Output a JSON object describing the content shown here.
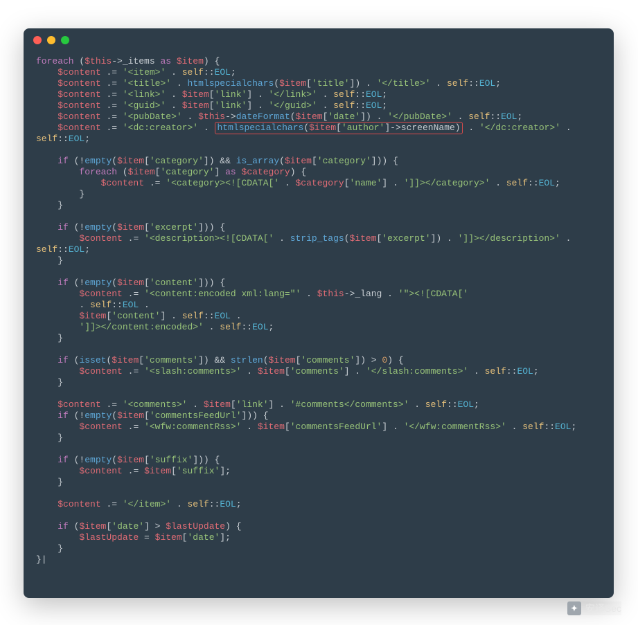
{
  "watermark": {
    "label": "安译Sec"
  },
  "code": {
    "tokens": [
      [
        [
          "kw",
          "foreach"
        ],
        [
          "op",
          " ("
        ],
        [
          "var",
          "$this"
        ],
        [
          "op",
          "->"
        ],
        [
          "plain",
          "_items "
        ],
        [
          "kw",
          "as"
        ],
        [
          "plain",
          " "
        ],
        [
          "var",
          "$item"
        ],
        [
          "op",
          ") {"
        ]
      ],
      [
        [
          "plain",
          "    "
        ],
        [
          "var",
          "$content"
        ],
        [
          "op",
          " .= "
        ],
        [
          "str",
          "'<item>'"
        ],
        [
          "op",
          " . "
        ],
        [
          "cls",
          "self"
        ],
        [
          "op",
          "::"
        ],
        [
          "cnst",
          "EOL"
        ],
        [
          "op",
          ";"
        ]
      ],
      [
        [
          "plain",
          "    "
        ],
        [
          "var",
          "$content"
        ],
        [
          "op",
          " .= "
        ],
        [
          "str",
          "'<title>'"
        ],
        [
          "op",
          " . "
        ],
        [
          "fn",
          "htmlspecialchars"
        ],
        [
          "op",
          "("
        ],
        [
          "var",
          "$item"
        ],
        [
          "op",
          "["
        ],
        [
          "str",
          "'title'"
        ],
        [
          "op",
          "]) . "
        ],
        [
          "str",
          "'</title>'"
        ],
        [
          "op",
          " . "
        ],
        [
          "cls",
          "self"
        ],
        [
          "op",
          "::"
        ],
        [
          "cnst",
          "EOL"
        ],
        [
          "op",
          ";"
        ]
      ],
      [
        [
          "plain",
          "    "
        ],
        [
          "var",
          "$content"
        ],
        [
          "op",
          " .= "
        ],
        [
          "str",
          "'<link>'"
        ],
        [
          "op",
          " . "
        ],
        [
          "var",
          "$item"
        ],
        [
          "op",
          "["
        ],
        [
          "str",
          "'link'"
        ],
        [
          "op",
          "] . "
        ],
        [
          "str",
          "'</link>'"
        ],
        [
          "op",
          " . "
        ],
        [
          "cls",
          "self"
        ],
        [
          "op",
          "::"
        ],
        [
          "cnst",
          "EOL"
        ],
        [
          "op",
          ";"
        ]
      ],
      [
        [
          "plain",
          "    "
        ],
        [
          "var",
          "$content"
        ],
        [
          "op",
          " .= "
        ],
        [
          "str",
          "'<guid>'"
        ],
        [
          "op",
          " . "
        ],
        [
          "var",
          "$item"
        ],
        [
          "op",
          "["
        ],
        [
          "str",
          "'link'"
        ],
        [
          "op",
          "] . "
        ],
        [
          "str",
          "'</guid>'"
        ],
        [
          "op",
          " . "
        ],
        [
          "cls",
          "self"
        ],
        [
          "op",
          "::"
        ],
        [
          "cnst",
          "EOL"
        ],
        [
          "op",
          ";"
        ]
      ],
      [
        [
          "plain",
          "    "
        ],
        [
          "var",
          "$content"
        ],
        [
          "op",
          " .= "
        ],
        [
          "str",
          "'<pubDate>'"
        ],
        [
          "op",
          " . "
        ],
        [
          "var",
          "$this"
        ],
        [
          "op",
          "->"
        ],
        [
          "fn",
          "dateFormat"
        ],
        [
          "op",
          "("
        ],
        [
          "var",
          "$item"
        ],
        [
          "op",
          "["
        ],
        [
          "str",
          "'date'"
        ],
        [
          "op",
          "]) . "
        ],
        [
          "str",
          "'</pubDate>'"
        ],
        [
          "op",
          " . "
        ],
        [
          "cls",
          "self"
        ],
        [
          "op",
          "::"
        ],
        [
          "cnst",
          "EOL"
        ],
        [
          "op",
          ";"
        ]
      ],
      "HILITE_LINE",
      [
        [
          "cls",
          "self"
        ],
        [
          "op",
          "::"
        ],
        [
          "cnst",
          "EOL"
        ],
        [
          "op",
          ";"
        ]
      ],
      [],
      [
        [
          "plain",
          "    "
        ],
        [
          "kw",
          "if"
        ],
        [
          "op",
          " (!"
        ],
        [
          "fn",
          "empty"
        ],
        [
          "op",
          "("
        ],
        [
          "var",
          "$item"
        ],
        [
          "op",
          "["
        ],
        [
          "str",
          "'category'"
        ],
        [
          "op",
          "]) && "
        ],
        [
          "fn",
          "is_array"
        ],
        [
          "op",
          "("
        ],
        [
          "var",
          "$item"
        ],
        [
          "op",
          "["
        ],
        [
          "str",
          "'category'"
        ],
        [
          "op",
          "])) {"
        ]
      ],
      [
        [
          "plain",
          "        "
        ],
        [
          "kw",
          "foreach"
        ],
        [
          "op",
          " ("
        ],
        [
          "var",
          "$item"
        ],
        [
          "op",
          "["
        ],
        [
          "str",
          "'category'"
        ],
        [
          "op",
          "] "
        ],
        [
          "kw",
          "as"
        ],
        [
          "plain",
          " "
        ],
        [
          "var",
          "$category"
        ],
        [
          "op",
          ") {"
        ]
      ],
      [
        [
          "plain",
          "            "
        ],
        [
          "var",
          "$content"
        ],
        [
          "op",
          " .= "
        ],
        [
          "str",
          "'<category><![CDATA['"
        ],
        [
          "op",
          " . "
        ],
        [
          "var",
          "$category"
        ],
        [
          "op",
          "["
        ],
        [
          "str",
          "'name'"
        ],
        [
          "op",
          "] . "
        ],
        [
          "str",
          "']]></category>'"
        ],
        [
          "op",
          " . "
        ],
        [
          "cls",
          "self"
        ],
        [
          "op",
          "::"
        ],
        [
          "cnst",
          "EOL"
        ],
        [
          "op",
          ";"
        ]
      ],
      [
        [
          "plain",
          "        "
        ],
        [
          "op",
          "}"
        ]
      ],
      [
        [
          "plain",
          "    "
        ],
        [
          "op",
          "}"
        ]
      ],
      [],
      [
        [
          "plain",
          "    "
        ],
        [
          "kw",
          "if"
        ],
        [
          "op",
          " (!"
        ],
        [
          "fn",
          "empty"
        ],
        [
          "op",
          "("
        ],
        [
          "var",
          "$item"
        ],
        [
          "op",
          "["
        ],
        [
          "str",
          "'excerpt'"
        ],
        [
          "op",
          "])) {"
        ]
      ],
      [
        [
          "plain",
          "        "
        ],
        [
          "var",
          "$content"
        ],
        [
          "op",
          " .= "
        ],
        [
          "str",
          "'<description><![CDATA['"
        ],
        [
          "op",
          " . "
        ],
        [
          "fn",
          "strip_tags"
        ],
        [
          "op",
          "("
        ],
        [
          "var",
          "$item"
        ],
        [
          "op",
          "["
        ],
        [
          "str",
          "'excerpt'"
        ],
        [
          "op",
          "]) . "
        ],
        [
          "str",
          "']]></description>'"
        ],
        [
          "op",
          " . "
        ]
      ],
      [
        [
          "cls",
          "self"
        ],
        [
          "op",
          "::"
        ],
        [
          "cnst",
          "EOL"
        ],
        [
          "op",
          ";"
        ]
      ],
      [
        [
          "plain",
          "    "
        ],
        [
          "op",
          "}"
        ]
      ],
      [],
      [
        [
          "plain",
          "    "
        ],
        [
          "kw",
          "if"
        ],
        [
          "op",
          " (!"
        ],
        [
          "fn",
          "empty"
        ],
        [
          "op",
          "("
        ],
        [
          "var",
          "$item"
        ],
        [
          "op",
          "["
        ],
        [
          "str",
          "'content'"
        ],
        [
          "op",
          "])) {"
        ]
      ],
      [
        [
          "plain",
          "        "
        ],
        [
          "var",
          "$content"
        ],
        [
          "op",
          " .= "
        ],
        [
          "str",
          "'<content:encoded xml:lang=\"'"
        ],
        [
          "op",
          " . "
        ],
        [
          "var",
          "$this"
        ],
        [
          "op",
          "->"
        ],
        [
          "plain",
          "_lang . "
        ],
        [
          "str",
          "'\"><![CDATA['"
        ]
      ],
      [
        [
          "plain",
          "        . "
        ],
        [
          "cls",
          "self"
        ],
        [
          "op",
          "::"
        ],
        [
          "cnst",
          "EOL"
        ],
        [
          "op",
          " ."
        ]
      ],
      [
        [
          "plain",
          "        "
        ],
        [
          "var",
          "$item"
        ],
        [
          "op",
          "["
        ],
        [
          "str",
          "'content'"
        ],
        [
          "op",
          "] . "
        ],
        [
          "cls",
          "self"
        ],
        [
          "op",
          "::"
        ],
        [
          "cnst",
          "EOL"
        ],
        [
          "op",
          " ."
        ]
      ],
      [
        [
          "plain",
          "        "
        ],
        [
          "str",
          "']]></content:encoded>'"
        ],
        [
          "op",
          " . "
        ],
        [
          "cls",
          "self"
        ],
        [
          "op",
          "::"
        ],
        [
          "cnst",
          "EOL"
        ],
        [
          "op",
          ";"
        ]
      ],
      [
        [
          "plain",
          "    "
        ],
        [
          "op",
          "}"
        ]
      ],
      [],
      [
        [
          "plain",
          "    "
        ],
        [
          "kw",
          "if"
        ],
        [
          "op",
          " ("
        ],
        [
          "fn",
          "isset"
        ],
        [
          "op",
          "("
        ],
        [
          "var",
          "$item"
        ],
        [
          "op",
          "["
        ],
        [
          "str",
          "'comments'"
        ],
        [
          "op",
          "]) && "
        ],
        [
          "fn",
          "strlen"
        ],
        [
          "op",
          "("
        ],
        [
          "var",
          "$item"
        ],
        [
          "op",
          "["
        ],
        [
          "str",
          "'comments'"
        ],
        [
          "op",
          "]) > "
        ],
        [
          "num",
          "0"
        ],
        [
          "op",
          ") {"
        ]
      ],
      [
        [
          "plain",
          "        "
        ],
        [
          "var",
          "$content"
        ],
        [
          "op",
          " .= "
        ],
        [
          "str",
          "'<slash:comments>'"
        ],
        [
          "op",
          " . "
        ],
        [
          "var",
          "$item"
        ],
        [
          "op",
          "["
        ],
        [
          "str",
          "'comments'"
        ],
        [
          "op",
          "] . "
        ],
        [
          "str",
          "'</slash:comments>'"
        ],
        [
          "op",
          " . "
        ],
        [
          "cls",
          "self"
        ],
        [
          "op",
          "::"
        ],
        [
          "cnst",
          "EOL"
        ],
        [
          "op",
          ";"
        ]
      ],
      [
        [
          "plain",
          "    "
        ],
        [
          "op",
          "}"
        ]
      ],
      [],
      [
        [
          "plain",
          "    "
        ],
        [
          "var",
          "$content"
        ],
        [
          "op",
          " .= "
        ],
        [
          "str",
          "'<comments>'"
        ],
        [
          "op",
          " . "
        ],
        [
          "var",
          "$item"
        ],
        [
          "op",
          "["
        ],
        [
          "str",
          "'link'"
        ],
        [
          "op",
          "] . "
        ],
        [
          "str",
          "'#comments</comments>'"
        ],
        [
          "op",
          " . "
        ],
        [
          "cls",
          "self"
        ],
        [
          "op",
          "::"
        ],
        [
          "cnst",
          "EOL"
        ],
        [
          "op",
          ";"
        ]
      ],
      [
        [
          "plain",
          "    "
        ],
        [
          "kw",
          "if"
        ],
        [
          "op",
          " (!"
        ],
        [
          "fn",
          "empty"
        ],
        [
          "op",
          "("
        ],
        [
          "var",
          "$item"
        ],
        [
          "op",
          "["
        ],
        [
          "str",
          "'commentsFeedUrl'"
        ],
        [
          "op",
          "])) {"
        ]
      ],
      [
        [
          "plain",
          "        "
        ],
        [
          "var",
          "$content"
        ],
        [
          "op",
          " .= "
        ],
        [
          "str",
          "'<wfw:commentRss>'"
        ],
        [
          "op",
          " . "
        ],
        [
          "var",
          "$item"
        ],
        [
          "op",
          "["
        ],
        [
          "str",
          "'commentsFeedUrl'"
        ],
        [
          "op",
          "] . "
        ],
        [
          "str",
          "'</wfw:commentRss>'"
        ],
        [
          "op",
          " . "
        ],
        [
          "cls",
          "self"
        ],
        [
          "op",
          "::"
        ],
        [
          "cnst",
          "EOL"
        ],
        [
          "op",
          ";"
        ]
      ],
      [
        [
          "plain",
          "    "
        ],
        [
          "op",
          "}"
        ]
      ],
      [],
      [
        [
          "plain",
          "    "
        ],
        [
          "kw",
          "if"
        ],
        [
          "op",
          " (!"
        ],
        [
          "fn",
          "empty"
        ],
        [
          "op",
          "("
        ],
        [
          "var",
          "$item"
        ],
        [
          "op",
          "["
        ],
        [
          "str",
          "'suffix'"
        ],
        [
          "op",
          "])) {"
        ]
      ],
      [
        [
          "plain",
          "        "
        ],
        [
          "var",
          "$content"
        ],
        [
          "op",
          " .= "
        ],
        [
          "var",
          "$item"
        ],
        [
          "op",
          "["
        ],
        [
          "str",
          "'suffix'"
        ],
        [
          "op",
          "];"
        ]
      ],
      [
        [
          "plain",
          "    "
        ],
        [
          "op",
          "}"
        ]
      ],
      [],
      [
        [
          "plain",
          "    "
        ],
        [
          "var",
          "$content"
        ],
        [
          "op",
          " .= "
        ],
        [
          "str",
          "'</item>'"
        ],
        [
          "op",
          " . "
        ],
        [
          "cls",
          "self"
        ],
        [
          "op",
          "::"
        ],
        [
          "cnst",
          "EOL"
        ],
        [
          "op",
          ";"
        ]
      ],
      [],
      [
        [
          "plain",
          "    "
        ],
        [
          "kw",
          "if"
        ],
        [
          "op",
          " ("
        ],
        [
          "var",
          "$item"
        ],
        [
          "op",
          "["
        ],
        [
          "str",
          "'date'"
        ],
        [
          "op",
          "] > "
        ],
        [
          "var",
          "$lastUpdate"
        ],
        [
          "op",
          ") {"
        ]
      ],
      [
        [
          "plain",
          "        "
        ],
        [
          "var",
          "$lastUpdate"
        ],
        [
          "op",
          " = "
        ],
        [
          "var",
          "$item"
        ],
        [
          "op",
          "["
        ],
        [
          "str",
          "'date'"
        ],
        [
          "op",
          "];"
        ]
      ],
      [
        [
          "plain",
          "    "
        ],
        [
          "op",
          "}"
        ]
      ],
      [
        [
          "op",
          "}|"
        ]
      ]
    ],
    "hilite_line": {
      "prefix": [
        [
          "plain",
          "    "
        ],
        [
          "var",
          "$content"
        ],
        [
          "op",
          " .= "
        ],
        [
          "str",
          "'<dc:creator>'"
        ],
        [
          "op",
          " . "
        ]
      ],
      "box": [
        [
          "fn",
          "htmlspecialchars"
        ],
        [
          "op",
          "("
        ],
        [
          "var",
          "$item"
        ],
        [
          "op",
          "["
        ],
        [
          "str",
          "'author'"
        ],
        [
          "op",
          "]->screenName)"
        ]
      ],
      "suffix": [
        [
          "op",
          " . "
        ],
        [
          "str",
          "'</dc:creator>'"
        ],
        [
          "op",
          " . "
        ]
      ]
    }
  }
}
